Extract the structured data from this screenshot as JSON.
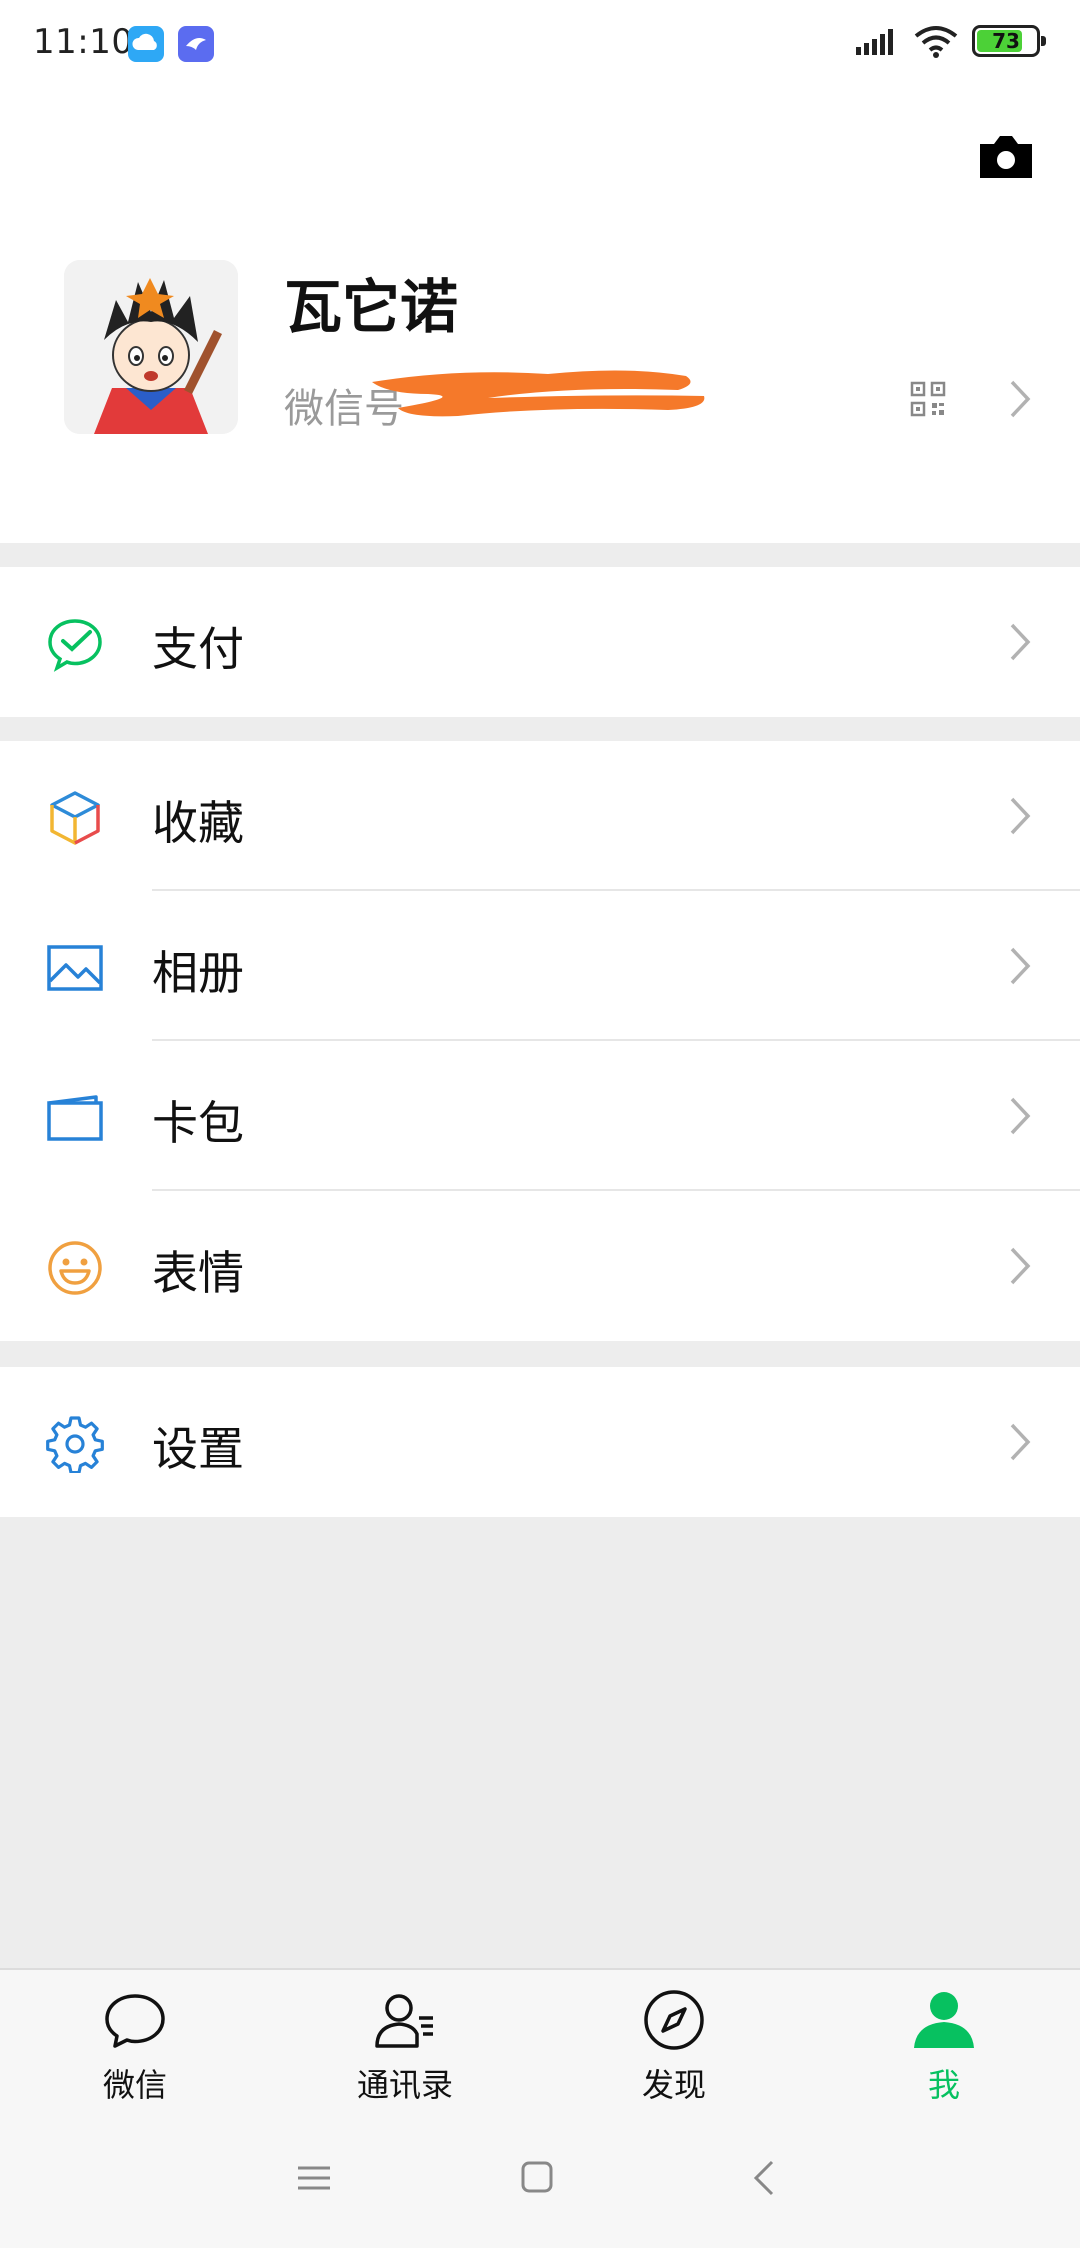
{
  "status_bar": {
    "time": "11:10",
    "battery": "73",
    "icons": [
      "cloud-app-icon",
      "bird-app-icon",
      "signal-icon",
      "wifi-icon",
      "battery-icon"
    ]
  },
  "profile": {
    "nickname": "瓦它诺",
    "wechat_id_label": "微信号",
    "icons": [
      "camera-icon",
      "qr-code-icon",
      "chevron-right-icon"
    ]
  },
  "menu": {
    "pay": {
      "label": "支付",
      "icon": "wechat-pay-icon",
      "color": "#07c160"
    },
    "favorites": {
      "label": "收藏",
      "icon": "cube-icon"
    },
    "album": {
      "label": "相册",
      "icon": "photo-icon",
      "color": "#2782d7"
    },
    "cards": {
      "label": "卡包",
      "icon": "card-wallet-icon",
      "color": "#2782d7"
    },
    "stickers": {
      "label": "表情",
      "icon": "smiley-icon",
      "color": "#f0a040"
    },
    "settings": {
      "label": "设置",
      "icon": "gear-icon",
      "color": "#2782d7"
    }
  },
  "tabbar": {
    "tabs": [
      {
        "label": "微信",
        "icon": "chat-bubble-icon"
      },
      {
        "label": "通讯录",
        "icon": "contacts-icon"
      },
      {
        "label": "发现",
        "icon": "compass-icon"
      },
      {
        "label": "我",
        "icon": "person-icon",
        "active": true
      }
    ],
    "active_color": "#07c160"
  },
  "system_nav": [
    "menu-icon",
    "home-icon",
    "back-icon"
  ]
}
